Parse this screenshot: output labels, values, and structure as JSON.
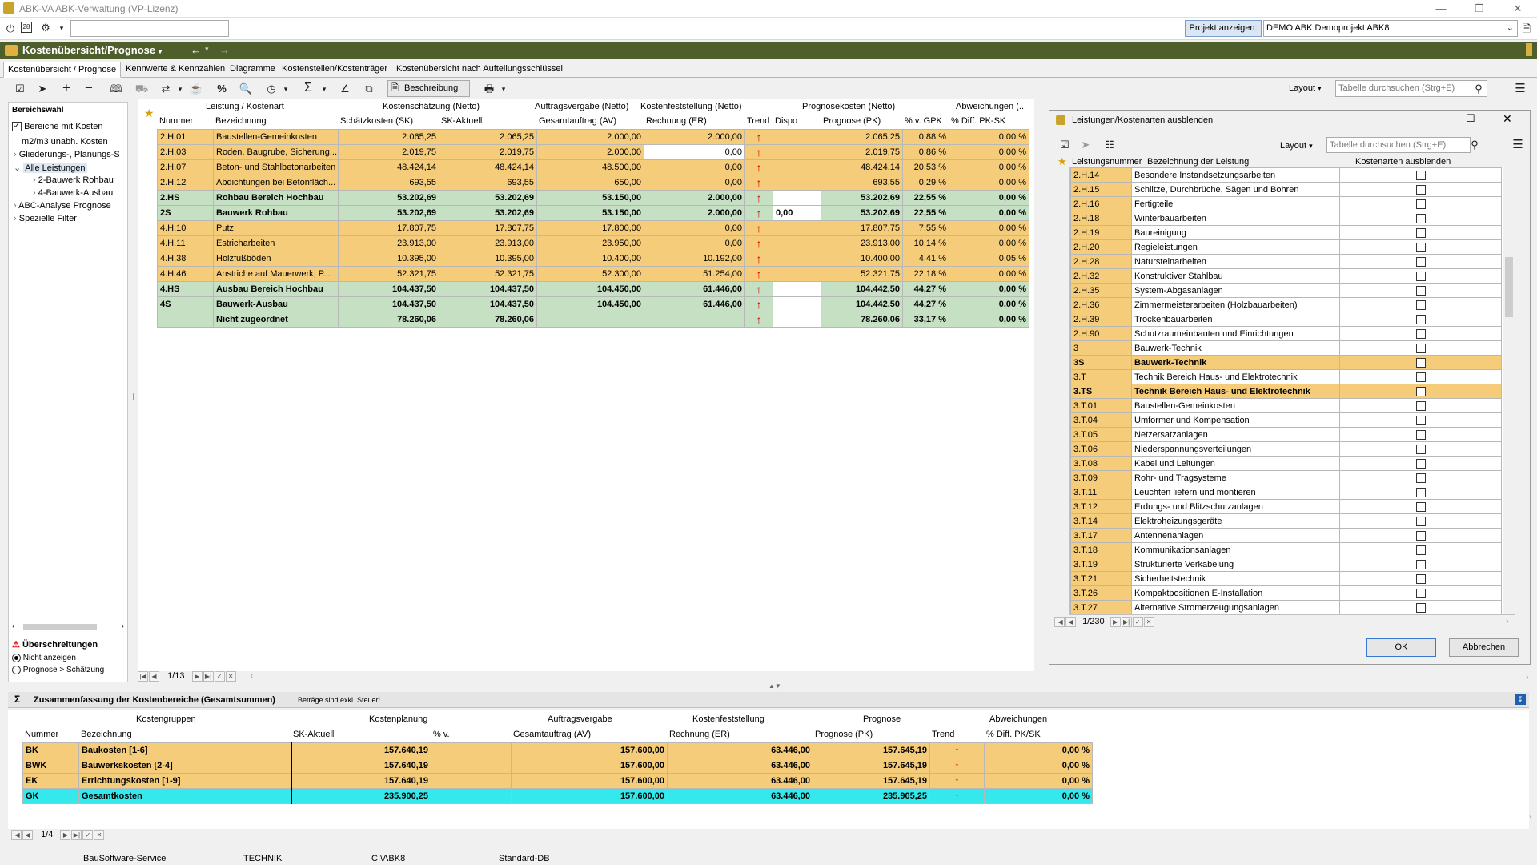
{
  "window": {
    "title": "ABK-VA  ABK-Verwaltung (VP-Lizenz)"
  },
  "toolbar": {
    "project_button": "Projekt anzeigen:",
    "project_value": "DEMO ABK   Demoprojekt ABK8"
  },
  "module": {
    "title": "Kostenübersicht/Prognose"
  },
  "tabs": [
    "Kostenübersicht / Prognose",
    "Kennwerte & Kennzahlen",
    "Diagramme",
    "Kostenstellen/Kostenträger",
    "Kostenübersicht nach Aufteilungsschlüssel"
  ],
  "toolbar2": {
    "beschreibung": "Beschreibung",
    "layout": "Layout",
    "search_placeholder": "Tabelle durchsuchen (Strg+E)"
  },
  "left": {
    "title": "Bereichswahl",
    "checkbox": "Bereiche mit Kosten",
    "items": [
      "m2/m3 unabh. Kosten",
      "Gliederungs-, Planungs-S",
      "Alle Leistungen",
      "2-Bauwerk Rohbau",
      "4-Bauwerk-Ausbau",
      "ABC-Analyse Prognose",
      "Spezielle Filter"
    ],
    "overrun_title": "Überschreitungen",
    "radio1": "Nicht anzeigen",
    "radio2": "Prognose > Schätzung"
  },
  "grid": {
    "groups": [
      "Leistung / Kostenart",
      "Kostenschätzung (Netto)",
      "Auftragsvergabe (Netto)",
      "Kostenfeststellung (Netto)",
      "Prognosekosten (Netto)",
      "Abweichungen (..."
    ],
    "columns": [
      "Nummer",
      "Bezeichnung",
      "Schätzkosten (SK)",
      "SK-Aktuell",
      "Gesamtauftrag (AV)",
      "Rechnung (ER)",
      "Trend",
      "Dispo",
      "Prognose (PK)",
      "% v. GPK",
      "% Diff. PK-SK"
    ],
    "rows": [
      {
        "t": "or",
        "c": [
          "2.H.01",
          "Baustellen-Gemeinkosten",
          "2.065,25",
          "2.065,25",
          "2.000,00",
          "2.000,00",
          "↑",
          "",
          "2.065,25",
          "0,88 %",
          "0,00 %"
        ]
      },
      {
        "t": "or",
        "c": [
          "2.H.03",
          "Roden, Baugrube, Sicherung...",
          "2.019,75",
          "2.019,75",
          "2.000,00",
          "0,00",
          "↑",
          "",
          "2.019,75",
          "0,86 %",
          "0,00 %"
        ]
      },
      {
        "t": "or",
        "c": [
          "2.H.07",
          "Beton- und Stahlbetonarbeiten",
          "48.424,14",
          "48.424,14",
          "48.500,00",
          "0,00",
          "↑",
          "",
          "48.424,14",
          "20,53 %",
          "0,00 %"
        ]
      },
      {
        "t": "or",
        "c": [
          "2.H.12",
          "Abdichtungen bei Betonfläch...",
          "693,55",
          "693,55",
          "650,00",
          "0,00",
          "↑",
          "",
          "693,55",
          "0,29 %",
          "0,00 %"
        ]
      },
      {
        "t": "gr",
        "c": [
          "2.HS",
          "Rohbau Bereich  Hochbau",
          "53.202,69",
          "53.202,69",
          "53.150,00",
          "2.000,00",
          "↑",
          "",
          "53.202,69",
          "22,55 %",
          "0,00 %"
        ]
      },
      {
        "t": "gr",
        "c": [
          "2S",
          "Bauwerk Rohbau",
          "53.202,69",
          "53.202,69",
          "53.150,00",
          "2.000,00",
          "↑",
          "0,00",
          "53.202,69",
          "22,55 %",
          "0,00 %"
        ]
      },
      {
        "t": "or",
        "c": [
          "4.H.10",
          "Putz",
          "17.807,75",
          "17.807,75",
          "17.800,00",
          "0,00",
          "↑",
          "",
          "17.807,75",
          "7,55 %",
          "0,00 %"
        ]
      },
      {
        "t": "or",
        "c": [
          "4.H.11",
          "Estricharbeiten",
          "23.913,00",
          "23.913,00",
          "23.950,00",
          "0,00",
          "↑",
          "",
          "23.913,00",
          "10,14 %",
          "0,00 %"
        ]
      },
      {
        "t": "or",
        "c": [
          "4.H.38",
          "Holzfußböden",
          "10.395,00",
          "10.395,00",
          "10.400,00",
          "10.192,00",
          "↑",
          "",
          "10.400,00",
          "4,41 %",
          "0,05 %"
        ]
      },
      {
        "t": "or",
        "c": [
          "4.H.46",
          "Anstriche auf Mauerwerk, P...",
          "52.321,75",
          "52.321,75",
          "52.300,00",
          "51.254,00",
          "↑",
          "",
          "52.321,75",
          "22,18 %",
          "0,00 %"
        ]
      },
      {
        "t": "gr",
        "c": [
          "4.HS",
          "Ausbau Bereich Hochbau",
          "104.437,50",
          "104.437,50",
          "104.450,00",
          "61.446,00",
          "↑",
          "",
          "104.442,50",
          "44,27 %",
          "0,00 %"
        ]
      },
      {
        "t": "gr",
        "c": [
          "4S",
          "Bauwerk-Ausbau",
          "104.437,50",
          "104.437,50",
          "104.450,00",
          "61.446,00",
          "↑",
          "",
          "104.442,50",
          "44,27 %",
          "0,00 %"
        ]
      },
      {
        "t": "gr",
        "c": [
          "",
          "Nicht zugeordnet",
          "78.260,06",
          "78.260,06",
          "",
          "",
          "↑",
          "",
          "78.260,06",
          "33,17 %",
          "0,00 %"
        ]
      }
    ],
    "pager": "1/13"
  },
  "dialog": {
    "title": "Leistungen/Kostenarten ausblenden",
    "layout": "Layout",
    "search_placeholder": "Tabelle durchsuchen (Strg+E)",
    "columns": [
      "Leistungsnummer",
      "Bezeichnung der Leistung",
      "Kostenarten ausblenden"
    ],
    "rows": [
      [
        "2.H.14",
        "Besondere Instandsetzungsarbeiten",
        0
      ],
      [
        "2.H.15",
        "Schlitze, Durchbrüche, Sägen und Bohren",
        0
      ],
      [
        "2.H.16",
        "Fertigteile",
        0
      ],
      [
        "2.H.18",
        "Winterbauarbeiten",
        0
      ],
      [
        "2.H.19",
        "Baureinigung",
        0
      ],
      [
        "2.H.20",
        "Regieleistungen",
        0
      ],
      [
        "2.H.28",
        "Natursteinarbeiten",
        0
      ],
      [
        "2.H.32",
        "Konstruktiver Stahlbau",
        0
      ],
      [
        "2.H.35",
        "System-Abgasanlagen",
        0
      ],
      [
        "2.H.36",
        "Zimmermeisterarbeiten (Holzbauarbeiten)",
        0
      ],
      [
        "2.H.39",
        "Trockenbauarbeiten",
        0
      ],
      [
        "2.H.90",
        "Schutzraumeinbauten und Einrichtungen",
        0
      ],
      [
        "3",
        "Bauwerk-Technik",
        0
      ],
      [
        "3S",
        "Bauwerk-Technik",
        1
      ],
      [
        "3.T",
        "Technik Bereich  Haus- und Elektrotechnik",
        0
      ],
      [
        "3.TS",
        "Technik Bereich  Haus- und Elektrotechnik",
        1
      ],
      [
        "3.T.01",
        "Baustellen-Gemeinkosten",
        0
      ],
      [
        "3.T.04",
        "Umformer und Kompensation",
        0
      ],
      [
        "3.T.05",
        "Netzersatzanlagen",
        0
      ],
      [
        "3.T.06",
        "Niederspannungsverteilungen",
        0
      ],
      [
        "3.T.08",
        "Kabel und Leitungen",
        0
      ],
      [
        "3.T.09",
        "Rohr- und Tragsysteme",
        0
      ],
      [
        "3.T.11",
        "Leuchten liefern und montieren",
        0
      ],
      [
        "3.T.12",
        "Erdungs- und Blitzschutzanlagen",
        0
      ],
      [
        "3.T.14",
        "Elektroheizungsgeräte",
        0
      ],
      [
        "3.T.17",
        "Antennenanlagen",
        0
      ],
      [
        "3.T.18",
        "Kommunikationsanlagen",
        0
      ],
      [
        "3.T.19",
        "Strukturierte Verkabelung",
        0
      ],
      [
        "3.T.21",
        "Sicherheitstechnik",
        0
      ],
      [
        "3.T.26",
        "Kompaktpositionen E-Installation",
        0
      ],
      [
        "3.T.27",
        "Alternative Stromerzeugungsanlagen",
        0
      ]
    ],
    "pager": "1/230",
    "ok": "OK",
    "cancel": "Abbrechen"
  },
  "summary": {
    "title": "Zusammenfassung der Kostenbereiche (Gesamtsummen)",
    "note": "Beträge sind exkl. Steuer!",
    "groups": [
      "Kostengruppen",
      "Kostenplanung",
      "Auftragsvergabe",
      "Kostenfeststellung",
      "Prognose",
      "Abweichungen"
    ],
    "columns": [
      "Nummer",
      "Bezeichnung",
      "SK-Aktuell",
      "% v.",
      "Gesamtauftrag (AV)",
      "Rechnung (ER)",
      "Prognose (PK)",
      "Trend",
      "% Diff. PK/SK"
    ],
    "rows": [
      {
        "t": "or",
        "c": [
          "BK",
          "Baukosten  [1-6]",
          "157.640,19",
          "",
          "157.600,00",
          "63.446,00",
          "157.645,19",
          "↑",
          "0,00 %"
        ]
      },
      {
        "t": "or",
        "c": [
          "BWK",
          "Bauwerkskosten  [2-4]",
          "157.640,19",
          "",
          "157.600,00",
          "63.446,00",
          "157.645,19",
          "↑",
          "0,00 %"
        ]
      },
      {
        "t": "or",
        "c": [
          "EK",
          "Errichtungskosten  [1-9]",
          "157.640,19",
          "",
          "157.600,00",
          "63.446,00",
          "157.645,19",
          "↑",
          "0,00 %"
        ]
      },
      {
        "t": "cy",
        "c": [
          "GK",
          "Gesamtkosten",
          "235.900,25",
          "",
          "157.600,00",
          "63.446,00",
          "235.905,25",
          "↑",
          "0,00 %"
        ]
      }
    ],
    "pager": "1/4"
  },
  "status": [
    "BauSoftware-Service",
    "TECHNIK",
    "C:\\ABK8",
    "Standard-DB"
  ]
}
